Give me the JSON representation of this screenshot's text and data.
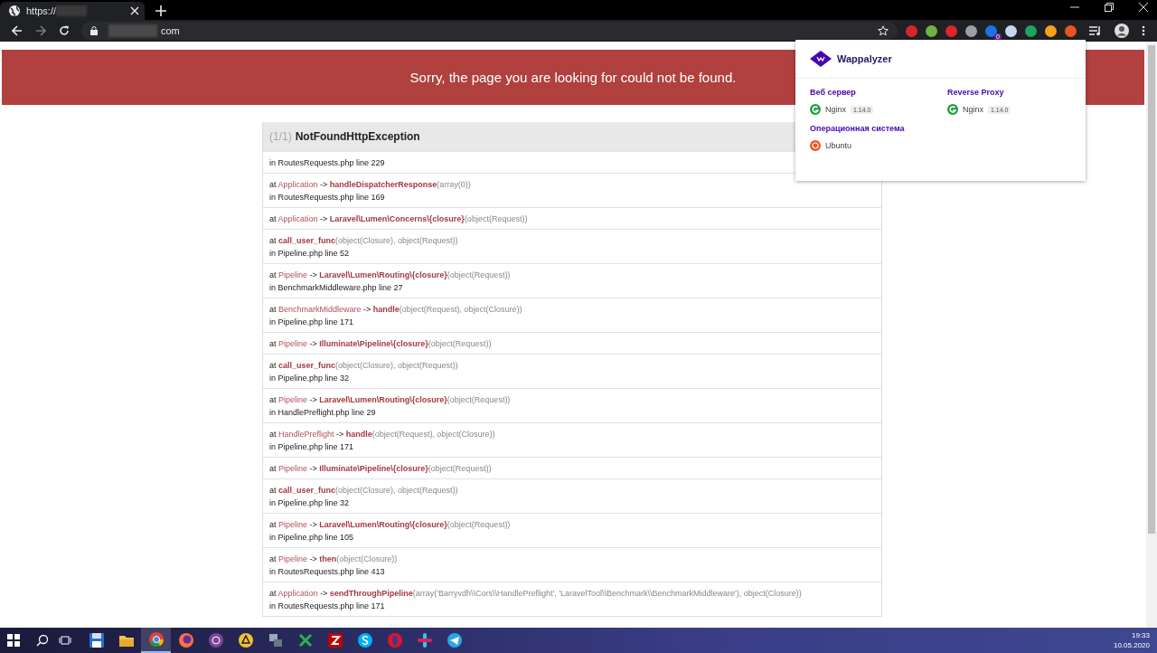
{
  "browser": {
    "tab": {
      "title": "https://",
      "selected": true
    },
    "address": {
      "domain_end": "com"
    },
    "extensions": [
      {
        "color": "#d9252a"
      },
      {
        "color": "#6cb33f"
      },
      {
        "color": "#e0262b"
      },
      {
        "color": "#9aa0a6"
      },
      {
        "color": "#1a73e8",
        "badge": "0"
      },
      {
        "color": "#c7d7f0"
      },
      {
        "color": "#1ea362"
      },
      {
        "color": "#f4a21a"
      },
      {
        "color": "#e95420"
      }
    ]
  },
  "error_page": {
    "banner": "Sorry, the page you are looking for could not be found.",
    "exception": {
      "counter": "(1/1)",
      "name": "NotFoundHttpException"
    },
    "frames": [
      {
        "location": "in RoutesRequests.php line 229"
      },
      {
        "call": [
          {
            "kind": "plain",
            "text": "at "
          },
          {
            "kind": "class",
            "text": "Application"
          },
          {
            "kind": "plain",
            "text": " -> "
          },
          {
            "kind": "func",
            "text": "handleDispatcherResponse"
          },
          {
            "kind": "args",
            "text": "(array(0))"
          }
        ],
        "location": "in RoutesRequests.php line 169"
      },
      {
        "call": [
          {
            "kind": "plain",
            "text": "at "
          },
          {
            "kind": "class",
            "text": "Application"
          },
          {
            "kind": "plain",
            "text": " -> "
          },
          {
            "kind": "func",
            "text": "Laravel\\Lumen\\Concerns\\{closure}"
          },
          {
            "kind": "args",
            "text": "(object(Request))"
          }
        ]
      },
      {
        "call": [
          {
            "kind": "plain",
            "text": "at  "
          },
          {
            "kind": "func",
            "text": "call_user_func"
          },
          {
            "kind": "args",
            "text": "(object(Closure), object(Request))"
          }
        ],
        "location": "in Pipeline.php line 52"
      },
      {
        "call": [
          {
            "kind": "plain",
            "text": "at "
          },
          {
            "kind": "class",
            "text": "Pipeline"
          },
          {
            "kind": "plain",
            "text": " -> "
          },
          {
            "kind": "func",
            "text": "Laravel\\Lumen\\Routing\\{closure}"
          },
          {
            "kind": "args",
            "text": "(object(Request))"
          }
        ],
        "location": "in BenchmarkMiddleware.php line 27"
      },
      {
        "call": [
          {
            "kind": "plain",
            "text": "at "
          },
          {
            "kind": "class",
            "text": "BenchmarkMiddleware"
          },
          {
            "kind": "plain",
            "text": " -> "
          },
          {
            "kind": "func",
            "text": "handle"
          },
          {
            "kind": "args",
            "text": "(object(Request), object(Closure))"
          }
        ],
        "location": "in Pipeline.php line 171"
      },
      {
        "call": [
          {
            "kind": "plain",
            "text": "at "
          },
          {
            "kind": "class",
            "text": "Pipeline"
          },
          {
            "kind": "plain",
            "text": " -> "
          },
          {
            "kind": "func",
            "text": "Illuminate\\Pipeline\\{closure}"
          },
          {
            "kind": "args",
            "text": "(object(Request))"
          }
        ]
      },
      {
        "call": [
          {
            "kind": "plain",
            "text": "at  "
          },
          {
            "kind": "func",
            "text": "call_user_func"
          },
          {
            "kind": "args",
            "text": "(object(Closure), object(Request))"
          }
        ],
        "location": "in Pipeline.php line 32"
      },
      {
        "call": [
          {
            "kind": "plain",
            "text": "at "
          },
          {
            "kind": "class",
            "text": "Pipeline"
          },
          {
            "kind": "plain",
            "text": " -> "
          },
          {
            "kind": "func",
            "text": "Laravel\\Lumen\\Routing\\{closure}"
          },
          {
            "kind": "args",
            "text": "(object(Request))"
          }
        ],
        "location": "in HandlePreflight.php line 29"
      },
      {
        "call": [
          {
            "kind": "plain",
            "text": "at "
          },
          {
            "kind": "class",
            "text": "HandlePreflight"
          },
          {
            "kind": "plain",
            "text": " -> "
          },
          {
            "kind": "func",
            "text": "handle"
          },
          {
            "kind": "args",
            "text": "(object(Request), object(Closure))"
          }
        ],
        "location": "in Pipeline.php line 171"
      },
      {
        "call": [
          {
            "kind": "plain",
            "text": "at "
          },
          {
            "kind": "class",
            "text": "Pipeline"
          },
          {
            "kind": "plain",
            "text": " -> "
          },
          {
            "kind": "func",
            "text": "Illuminate\\Pipeline\\{closure}"
          },
          {
            "kind": "args",
            "text": "(object(Request))"
          }
        ]
      },
      {
        "call": [
          {
            "kind": "plain",
            "text": "at  "
          },
          {
            "kind": "func",
            "text": "call_user_func"
          },
          {
            "kind": "args",
            "text": "(object(Closure), object(Request))"
          }
        ],
        "location": "in Pipeline.php line 32"
      },
      {
        "call": [
          {
            "kind": "plain",
            "text": "at "
          },
          {
            "kind": "class",
            "text": "Pipeline"
          },
          {
            "kind": "plain",
            "text": " -> "
          },
          {
            "kind": "func",
            "text": "Laravel\\Lumen\\Routing\\{closure}"
          },
          {
            "kind": "args",
            "text": "(object(Request))"
          }
        ],
        "location": "in Pipeline.php line 105"
      },
      {
        "call": [
          {
            "kind": "plain",
            "text": "at "
          },
          {
            "kind": "class",
            "text": "Pipeline"
          },
          {
            "kind": "plain",
            "text": " -> "
          },
          {
            "kind": "func",
            "text": "then"
          },
          {
            "kind": "args",
            "text": "(object(Closure))"
          }
        ],
        "location": "in RoutesRequests.php line 413"
      },
      {
        "call": [
          {
            "kind": "plain",
            "text": "at "
          },
          {
            "kind": "class",
            "text": "Application"
          },
          {
            "kind": "plain",
            "text": " -> "
          },
          {
            "kind": "func",
            "text": "sendThroughPipeline"
          },
          {
            "kind": "args",
            "text": "(array('Barryvdh\\\\Cors\\\\HandlePreflight', 'LaravelTool\\\\Benchmark\\\\BenchmarkMiddleware'), object(Closure))"
          }
        ],
        "location": "in RoutesRequests.php line 171"
      }
    ]
  },
  "wappalyzer": {
    "title": "Wappalyzer",
    "categories": [
      {
        "name": "Веб сервер",
        "technologies": [
          {
            "name": "Nginx",
            "version": "1.14.0",
            "kind": "webserver"
          }
        ]
      },
      {
        "name": "Reverse Proxy",
        "technologies": [
          {
            "name": "Nginx",
            "version": "1.14.0",
            "kind": "webserver"
          }
        ]
      },
      {
        "name": "Операционная система",
        "technologies": [
          {
            "name": "Ubuntu",
            "kind": "os"
          }
        ]
      }
    ]
  },
  "taskbar": {
    "apps": [
      {
        "kind": "save",
        "selected": false
      },
      {
        "kind": "folder",
        "selected": false
      },
      {
        "kind": "chrome",
        "selected": true
      },
      {
        "kind": "firefox",
        "selected": false
      },
      {
        "kind": "tor",
        "selected": false
      },
      {
        "kind": "warning",
        "selected": false
      },
      {
        "kind": "network",
        "selected": false
      },
      {
        "kind": "cross",
        "selected": false
      },
      {
        "kind": "filezilla",
        "selected": false
      },
      {
        "kind": "skype",
        "selected": false
      },
      {
        "kind": "opera",
        "selected": false
      },
      {
        "kind": "slack",
        "selected": false
      },
      {
        "kind": "telegram",
        "selected": false
      }
    ],
    "time": "19:33",
    "date": "10.05.2020"
  }
}
